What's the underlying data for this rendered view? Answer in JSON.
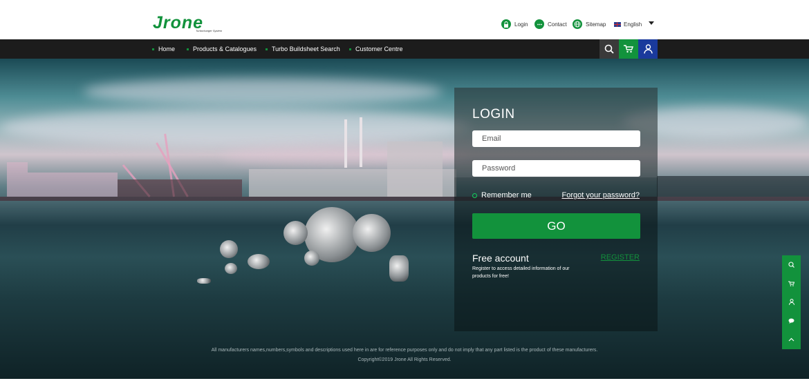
{
  "header": {
    "logo_text": "Jrone",
    "logo_tagline": "Turbocharger System",
    "login_label": "Login",
    "contact_label": "Contact",
    "sitemap_label": "Sitemap",
    "language_label": "English"
  },
  "nav": {
    "items": [
      {
        "label": "Home"
      },
      {
        "label": "Products & Catalogues"
      },
      {
        "label": "Turbo Buildsheet Search"
      },
      {
        "label": "Customer Centre"
      }
    ]
  },
  "login": {
    "title": "LOGIN",
    "email_placeholder": "Email",
    "password_placeholder": "Password",
    "remember_label": "Remember me",
    "forgot_label": "Forgot your password?",
    "go_label": "GO",
    "free_title": "Free account",
    "register_label": "REGISTER",
    "free_desc": "Register to access detailed information of our products for free!"
  },
  "footer": {
    "disclaimer": "All manufacturers names,numbers,symbols and descriptions used here in are for reference purposes only and do not imply that any part listed is the product of these manufacturers.",
    "copyright": "Copyright©2019 Jrone All Rights Reserved."
  },
  "colors": {
    "brand_green": "#12923c",
    "nav_dark": "#1c1c1c",
    "user_blue": "#1a3a9c"
  },
  "icons": {
    "login": "lock-icon",
    "contact": "chat-icon",
    "sitemap": "globe-icon",
    "search": "search-icon",
    "cart": "cart-icon",
    "user": "user-icon"
  }
}
